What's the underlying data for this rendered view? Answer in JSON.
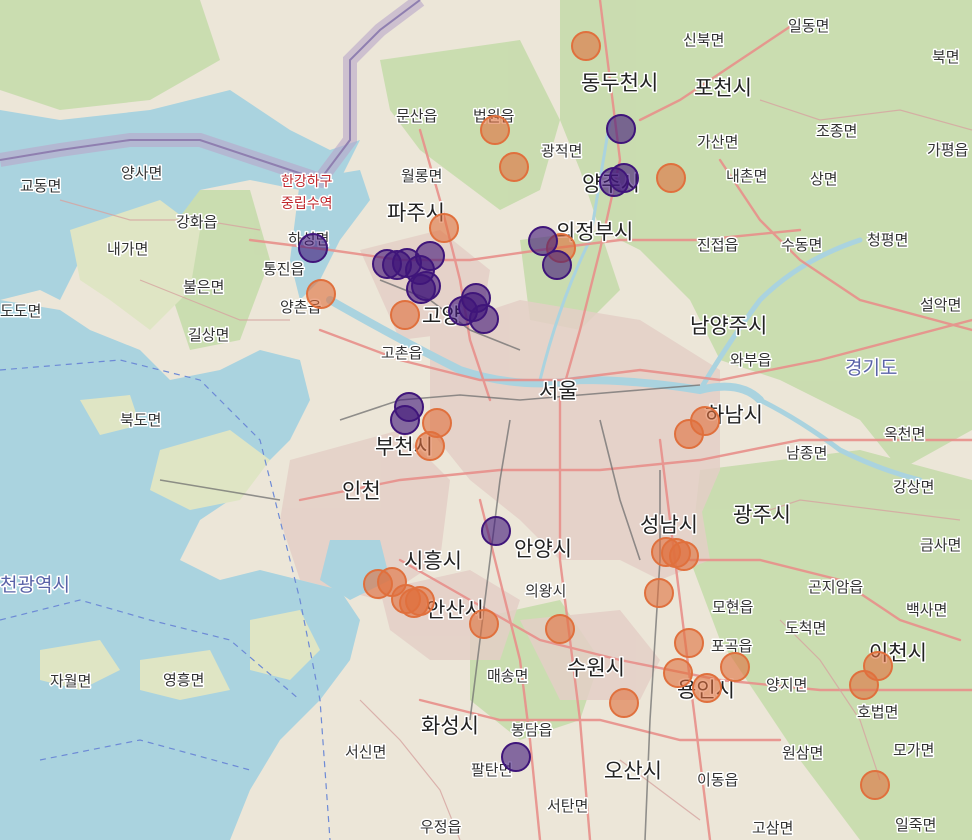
{
  "map": {
    "labels": {
      "dongducheon": "동두천시",
      "pocheon": "포천시",
      "ildong": "일동면",
      "sinbuk": "신북면",
      "bukmyeon": "북면",
      "munsan": "문산읍",
      "beobwon": "법원읍",
      "gwangjeok": "광적면",
      "gasan": "가산면",
      "jojong": "조종면",
      "gapyeong": "가평읍",
      "gyodong": "교동면",
      "yangsa": "양사면",
      "hangang_estuary_1": "한강하구",
      "hangang_estuary_2": "중립수역",
      "wollong": "월롱면",
      "yangju": "양주시",
      "naechon": "내촌면",
      "sang": "상면",
      "paju": "파주시",
      "uijeongbu": "의정부시",
      "ganghwa": "강화읍",
      "naega": "내가면",
      "haseong": "하성면",
      "jinjeop": "진접읍",
      "sudong": "수동면",
      "cheongpyeong": "청평면",
      "tongjin": "통진읍",
      "buleun": "불은면",
      "doto": "도도면",
      "yangchon": "양촌읍",
      "seorak": "설악면",
      "goyang": "고양",
      "gilsang": "길상면",
      "namyangju": "남양주시",
      "gochon": "고촌읍",
      "wabu": "와부읍",
      "seoul": "서울",
      "gyeonggi": "경기도",
      "bukdo": "북도면",
      "hanam": "하남시",
      "bucheon": "부천시",
      "namjong": "남종면",
      "okcheon": "옥천면",
      "incheon": "인천",
      "gangsang": "강상면",
      "gwangju": "광주시",
      "seongnam": "성남시",
      "geumsa": "금사면",
      "anyang": "안양시",
      "siheung": "시흥시",
      "incheon_metro": "천광역시",
      "uiwang": "의왕시",
      "gonjiam": "곤지암읍",
      "baeksa": "백사면",
      "mohyeon": "모현읍",
      "ansan": "안산시",
      "dochuk": "도척면",
      "pogok": "포곡읍",
      "icheon": "이천시",
      "jawol": "자월면",
      "yeongheung": "영흥면",
      "maesong": "매송면",
      "suwon": "수원시",
      "yangji": "양지면",
      "yongin": "용인시",
      "hobeop": "호법면",
      "hwaseong": "화성시",
      "bongdam": "봉담읍",
      "seosin": "서신면",
      "wonsam": "원삼면",
      "moga": "모가면",
      "paltan": "팔탄면",
      "osan": "오산시",
      "idong": "이동읍",
      "seotan": "서탄면",
      "ujeong": "우정읍",
      "gosam": "고삼면",
      "iljuk": "일죽면"
    },
    "colors": {
      "purple_marker": "#3f157a",
      "orange_marker": "#e0703d",
      "water": "#aad3df",
      "land": "#ece6d8",
      "forest": "#c8dcae",
      "urban": "#e2ccc4",
      "major_road": "#e8908b"
    },
    "markers": {
      "purple": 31,
      "orange": 38
    }
  }
}
